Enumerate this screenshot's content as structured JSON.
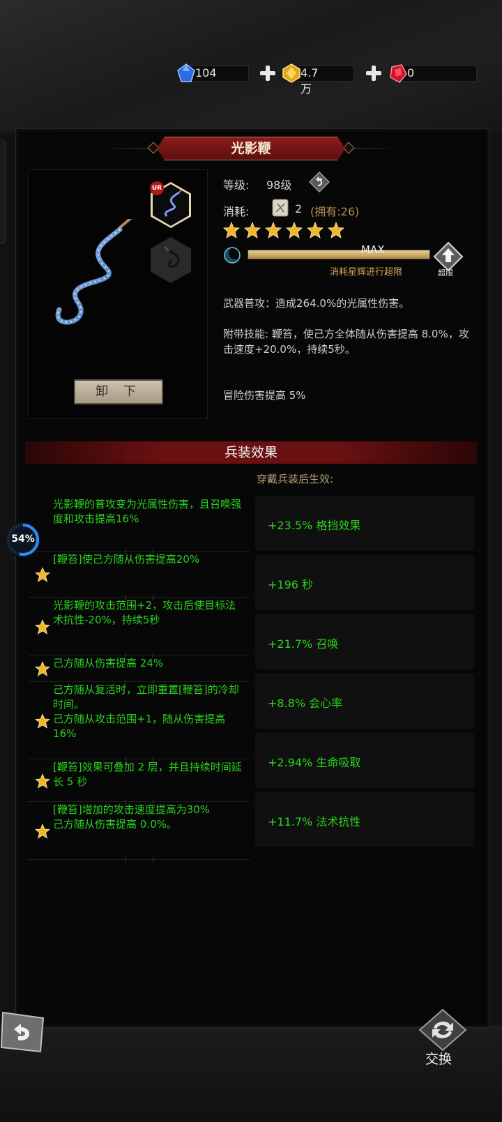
{
  "currency": {
    "diamond": "104",
    "gold": "4.7万",
    "ruby": "0"
  },
  "item": {
    "name": "光影鞭",
    "rarity_badge": "UR",
    "unload_label": "卸 下",
    "level_label": "等级:",
    "level_value": "98级",
    "cost_label": "消耗:",
    "cost_amount": "2",
    "cost_owned": "(拥有:26)",
    "stars": 6,
    "progress_fraction": 1.0,
    "progress_text": "MAX",
    "progress_hint": "消耗星辉进行超限",
    "limit_label": "超限",
    "desc_attack": "武器普攻：造成264.0%的光属性伤害。",
    "desc_skill": "附带技能: 鞭笞，使己方全体随从伤害提高 8.0%，攻击速度+20.0%，持续5秒。",
    "desc_bonus": "冒险伤害提高 5%"
  },
  "effects": {
    "title": "兵装效果",
    "subtitle": "穿戴兵装后生效:",
    "skills": [
      "光影鞭的普攻变为光属性伤害，且召唤强度和攻击提高16%",
      "[鞭笞]使己方随从伤害提高20%",
      "光影鞭的攻击范围+2，攻击后使目标法术抗性-20%，持续5秒",
      "己方随从伤害提高 24%",
      "己方随从复活时，立即重置[鞭笞]的冷却时间。\n己方随从攻击范围+1，随从伤害提高 16%",
      "[鞭笞]效果可叠加 2 层，并且持续时间延长 5 秒",
      "[鞭笞]增加的攻击速度提高为30%\n己方随从伤害提高 0.0%。"
    ],
    "stats": [
      "+23.5% 格挡效果",
      "+196 秒",
      "+21.7% 召唤",
      "+8.8% 会心率",
      "+2.94% 生命吸取",
      "+11.7% 法术抗性"
    ]
  },
  "loader": {
    "percent": "54%",
    "fraction": 0.54
  },
  "bottom": {
    "swap_label": "交换"
  },
  "colors": {
    "effect_green": "#2ad31f",
    "gold_text": "#b08d55",
    "banner_red": "#6a1010",
    "star_gold": "#f2b52c"
  },
  "icons": [
    "diamond-gem-icon",
    "gold-gem-icon",
    "ruby-gem-icon",
    "plus-icon",
    "undo-icon",
    "scroll-icon",
    "star-icon",
    "moon-icon",
    "up-arrow-icon",
    "back-arrow-icon",
    "swap-icon"
  ]
}
